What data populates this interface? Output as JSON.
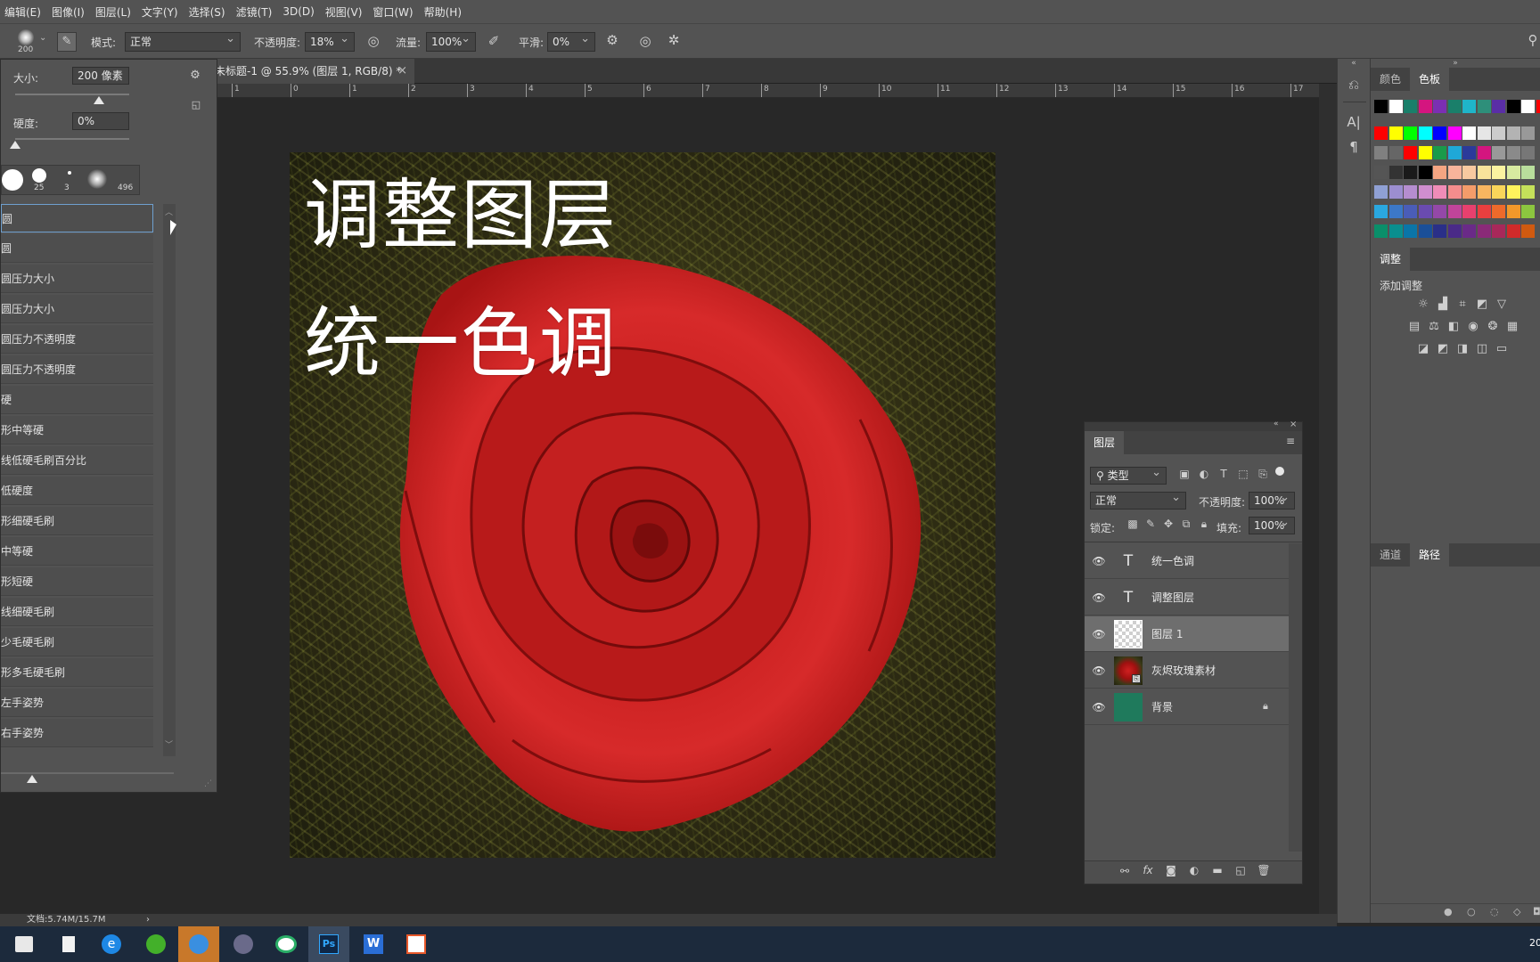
{
  "menubar": {
    "items": [
      "编辑(E)",
      "图像(I)",
      "图层(L)",
      "文字(Y)",
      "选择(S)",
      "滤镜(T)",
      "3D(D)",
      "视图(V)",
      "窗口(W)",
      "帮助(H)"
    ]
  },
  "options_bar": {
    "brush_size_badge": "200",
    "mode_label": "模式:",
    "mode_value": "正常",
    "opacity_label": "不透明度:",
    "opacity_value": "18%",
    "flow_label": "流量:",
    "flow_value": "100%",
    "smoothing_label": "平滑:",
    "smoothing_value": "0%"
  },
  "document_tab": {
    "title": "未标题-1 @ 55.9% (图层 1, RGB/8) *"
  },
  "ruler": {
    "ticks": [
      "1",
      "0",
      "1",
      "2",
      "3",
      "4",
      "5",
      "6",
      "7",
      "8",
      "9",
      "10",
      "11",
      "12",
      "13",
      "14",
      "15",
      "16",
      "17"
    ]
  },
  "brush_panel": {
    "size_label": "大小:",
    "size_value": "200 像素",
    "hardness_label": "硬度:",
    "hardness_value": "0%",
    "tip_sizes": [
      "25",
      "3",
      "496"
    ],
    "presets": [
      "圆",
      "圆",
      "圆压力大小",
      "圆压力大小",
      "圆压力不透明度",
      "圆压力不透明度",
      "硬",
      "形中等硬",
      "线低硬毛刷百分比",
      "低硬度",
      "形细硬毛刷",
      "中等硬",
      "形短硬",
      "线细硬毛刷",
      "少毛硬毛刷",
      "形多毛硬毛刷",
      "左手姿势",
      "右手姿势"
    ]
  },
  "canvas": {
    "line1": "调整图层",
    "line2": "统一色调"
  },
  "right_dock": {
    "color_tabs": [
      "颜色",
      "色板"
    ],
    "adjust_tab": "调整",
    "adjust_subtitle": "添加调整",
    "bottom_tabs": [
      "通道",
      "路径"
    ],
    "swatch_colors": {
      "row0": [
        "#000000",
        "#ffffff",
        "#1a7f6a",
        "#d4157f",
        "#7b2fb3",
        "#1a7f6a",
        "#1fb5c9",
        "#2e8f7a",
        "#5a2ea6",
        "#000000",
        "#ffffff",
        "#ff0000"
      ],
      "row1": [
        "#ff0000",
        "#ffff00",
        "#00ff00",
        "#00ffff",
        "#0000ff",
        "#ff00ff",
        "#ffffff",
        "#e6e6e6",
        "#cccccc",
        "#b3b3b3",
        "#999999"
      ],
      "row2": [
        "#808080",
        "#666666",
        "#ff0000",
        "#ffff00",
        "#1a9a4a",
        "#1fa8d8",
        "#2b3a9a",
        "#d4157f",
        "#999999",
        "#8a8a8a",
        "#777777"
      ],
      "row3": [
        "#555555",
        "#333333",
        "#1a1a1a",
        "#000000",
        "#f4a582",
        "#f7b49b",
        "#f8c9a0",
        "#f9e39b",
        "#fbf3a0",
        "#d8eaa0",
        "#b9de9c"
      ],
      "row4": [
        "#8fa0d4",
        "#9c8ed0",
        "#b58dcf",
        "#d08ecf",
        "#f08cb8",
        "#f58d8d",
        "#f49c6a",
        "#f7b560",
        "#f9d55a",
        "#fff35c",
        "#c4e05a"
      ],
      "row5": [
        "#2aa8e0",
        "#3c78c8",
        "#4a5db8",
        "#6a4bb0",
        "#9448a8",
        "#c0449a",
        "#e8406e",
        "#ea3f3f",
        "#ee6a2b",
        "#f2982a",
        "#8cc63f"
      ],
      "row6": [
        "#0a8f6a",
        "#0a8f8f",
        "#0a75a8",
        "#1a4f98",
        "#2a2f88",
        "#4a2a88",
        "#6a2a88",
        "#8a2a78",
        "#a8285a",
        "#d02a2a",
        "#d05a10"
      ]
    }
  },
  "layers_panel": {
    "title": "图层",
    "filter_label": "类型",
    "blend_mode": "正常",
    "opacity_label": "不透明度:",
    "opacity_value": "100%",
    "lock_label": "锁定:",
    "fill_label": "填充:",
    "fill_value": "100%",
    "layers": [
      {
        "name": "统一色调",
        "kind": "text",
        "selected": false
      },
      {
        "name": "调整图层",
        "kind": "text",
        "selected": false
      },
      {
        "name": "图层 1",
        "kind": "transparent",
        "selected": true
      },
      {
        "name": "灰烬玫瑰素材",
        "kind": "image",
        "selected": false
      },
      {
        "name": "背景",
        "kind": "fill",
        "fill_color": "#1f7a5c",
        "selected": false,
        "locked": true
      }
    ]
  },
  "status": {
    "doc_info": "文档:5.74M/15.7M"
  },
  "taskbar": {
    "apps": [
      "store-icon",
      "file-icon",
      "ie-icon",
      "browser-icon",
      "feishu-icon",
      "photo-icon",
      "wechat-icon",
      "photoshop-icon",
      "wps-icon",
      "ppt-icon"
    ],
    "ps_label": "Ps",
    "clock_fragment": "20"
  }
}
